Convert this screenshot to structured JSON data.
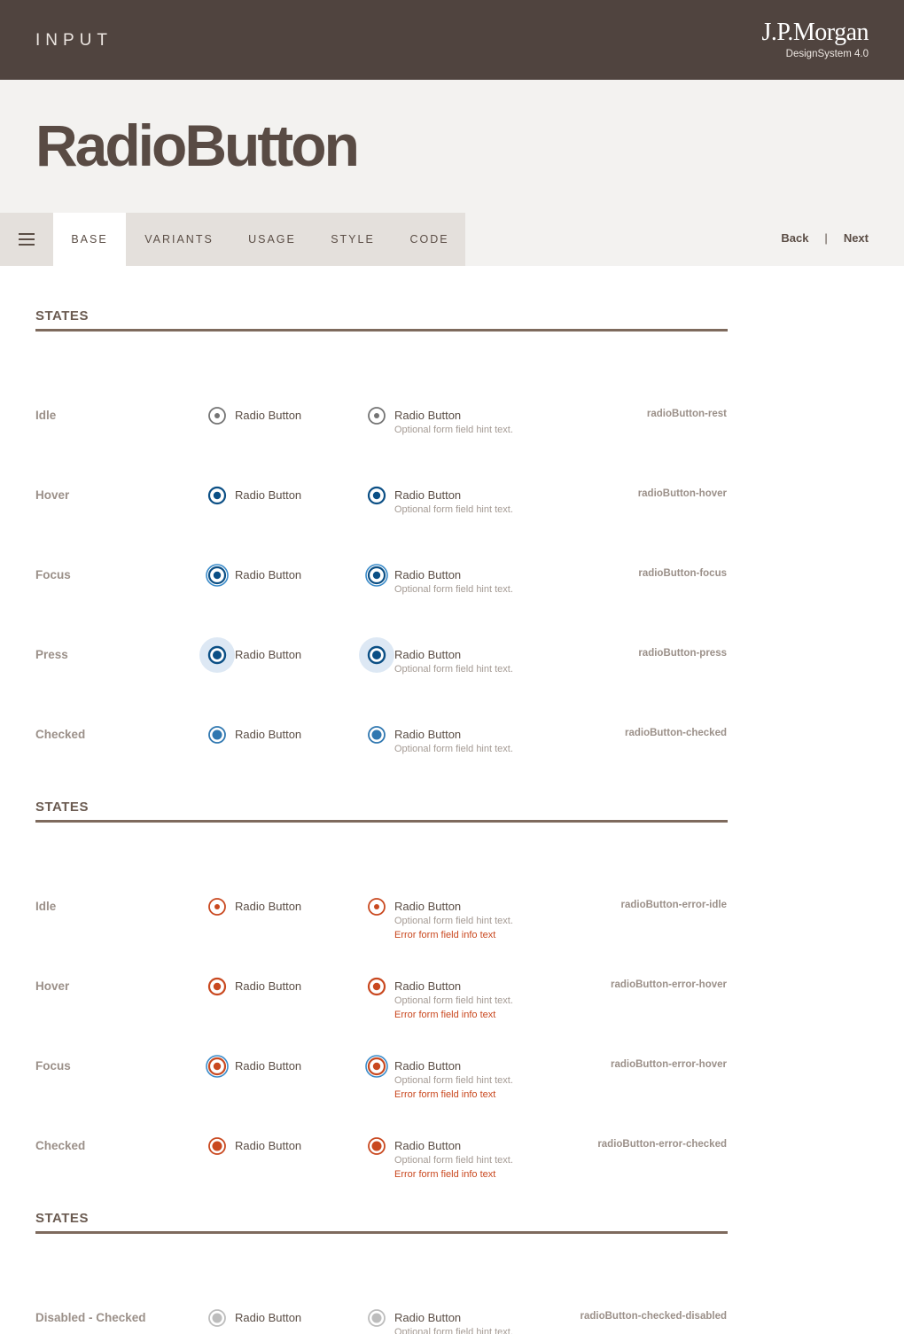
{
  "header": {
    "category": "INPUT",
    "brand": "J.P.Morgan",
    "design_system": "DesignSystem  4.0"
  },
  "hero": {
    "title": "RadioButton"
  },
  "tabs": [
    {
      "label": "BASE",
      "active": true
    },
    {
      "label": "VARIANTS"
    },
    {
      "label": "USAGE"
    },
    {
      "label": "STYLE"
    },
    {
      "label": "CODE"
    }
  ],
  "pager": {
    "back": "Back",
    "separator": "|",
    "next": "Next"
  },
  "common": {
    "radio_label": "Radio Button",
    "hint": "Optional form field hint text.",
    "error": "Error form field info text"
  },
  "sections": [
    {
      "title": "STATES",
      "rows": [
        {
          "label": "Idle",
          "token": "radioButton-rest",
          "state": "rest"
        },
        {
          "label": "Hover",
          "token": "radioButton-hover",
          "state": "hover"
        },
        {
          "label": "Focus",
          "token": "radioButton-focus",
          "state": "focus"
        },
        {
          "label": "Press",
          "token": "radioButton-press",
          "state": "press"
        },
        {
          "label": "Checked",
          "token": "radioButton-checked",
          "state": "checked"
        }
      ]
    },
    {
      "title": "STATES",
      "rows": [
        {
          "label": "Idle",
          "token": "radioButton-error-idle",
          "state": "error-idle"
        },
        {
          "label": "Hover",
          "token": "radioButton-error-hover",
          "state": "error-hover"
        },
        {
          "label": "Focus",
          "token": "radioButton-error-hover",
          "state": "error-focus"
        },
        {
          "label": "Checked",
          "token": "radioButton-error-checked",
          "state": "error-checked"
        }
      ]
    },
    {
      "title": "STATES",
      "rows": [
        {
          "label": "Disabled - Checked",
          "token": "radioButton-checked-disabled",
          "state": "disabled-checked"
        }
      ]
    }
  ],
  "colors": {
    "header_bg": "#50443f",
    "hero_bg": "#f3f2f0",
    "tab_bg": "#e4e0dc",
    "neutral": "#747474",
    "primary": "#0b4f85",
    "primary_light": "#3a8bc9",
    "checked": "#2f77b0",
    "press_bg": "#dde8f4",
    "error": "#c9481f",
    "disabled": "#bdbdbd"
  }
}
